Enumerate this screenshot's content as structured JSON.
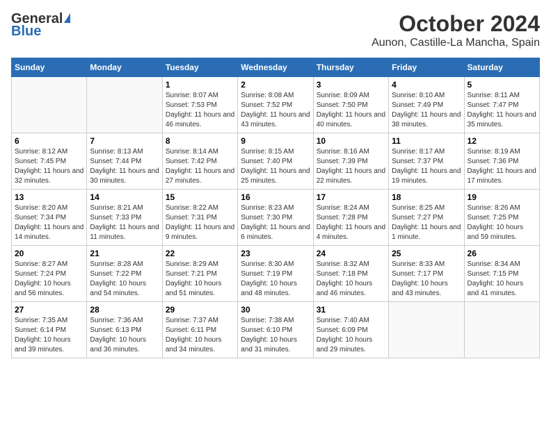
{
  "header": {
    "logo_general": "General",
    "logo_blue": "Blue",
    "month_title": "October 2024",
    "location": "Aunon, Castille-La Mancha, Spain"
  },
  "weekdays": [
    "Sunday",
    "Monday",
    "Tuesday",
    "Wednesday",
    "Thursday",
    "Friday",
    "Saturday"
  ],
  "weeks": [
    [
      {
        "day": "",
        "info": ""
      },
      {
        "day": "",
        "info": ""
      },
      {
        "day": "1",
        "info": "Sunrise: 8:07 AM\nSunset: 7:53 PM\nDaylight: 11 hours and 46 minutes."
      },
      {
        "day": "2",
        "info": "Sunrise: 8:08 AM\nSunset: 7:52 PM\nDaylight: 11 hours and 43 minutes."
      },
      {
        "day": "3",
        "info": "Sunrise: 8:09 AM\nSunset: 7:50 PM\nDaylight: 11 hours and 40 minutes."
      },
      {
        "day": "4",
        "info": "Sunrise: 8:10 AM\nSunset: 7:49 PM\nDaylight: 11 hours and 38 minutes."
      },
      {
        "day": "5",
        "info": "Sunrise: 8:11 AM\nSunset: 7:47 PM\nDaylight: 11 hours and 35 minutes."
      }
    ],
    [
      {
        "day": "6",
        "info": "Sunrise: 8:12 AM\nSunset: 7:45 PM\nDaylight: 11 hours and 32 minutes."
      },
      {
        "day": "7",
        "info": "Sunrise: 8:13 AM\nSunset: 7:44 PM\nDaylight: 11 hours and 30 minutes."
      },
      {
        "day": "8",
        "info": "Sunrise: 8:14 AM\nSunset: 7:42 PM\nDaylight: 11 hours and 27 minutes."
      },
      {
        "day": "9",
        "info": "Sunrise: 8:15 AM\nSunset: 7:40 PM\nDaylight: 11 hours and 25 minutes."
      },
      {
        "day": "10",
        "info": "Sunrise: 8:16 AM\nSunset: 7:39 PM\nDaylight: 11 hours and 22 minutes."
      },
      {
        "day": "11",
        "info": "Sunrise: 8:17 AM\nSunset: 7:37 PM\nDaylight: 11 hours and 19 minutes."
      },
      {
        "day": "12",
        "info": "Sunrise: 8:19 AM\nSunset: 7:36 PM\nDaylight: 11 hours and 17 minutes."
      }
    ],
    [
      {
        "day": "13",
        "info": "Sunrise: 8:20 AM\nSunset: 7:34 PM\nDaylight: 11 hours and 14 minutes."
      },
      {
        "day": "14",
        "info": "Sunrise: 8:21 AM\nSunset: 7:33 PM\nDaylight: 11 hours and 11 minutes."
      },
      {
        "day": "15",
        "info": "Sunrise: 8:22 AM\nSunset: 7:31 PM\nDaylight: 11 hours and 9 minutes."
      },
      {
        "day": "16",
        "info": "Sunrise: 8:23 AM\nSunset: 7:30 PM\nDaylight: 11 hours and 6 minutes."
      },
      {
        "day": "17",
        "info": "Sunrise: 8:24 AM\nSunset: 7:28 PM\nDaylight: 11 hours and 4 minutes."
      },
      {
        "day": "18",
        "info": "Sunrise: 8:25 AM\nSunset: 7:27 PM\nDaylight: 11 hours and 1 minute."
      },
      {
        "day": "19",
        "info": "Sunrise: 8:26 AM\nSunset: 7:25 PM\nDaylight: 10 hours and 59 minutes."
      }
    ],
    [
      {
        "day": "20",
        "info": "Sunrise: 8:27 AM\nSunset: 7:24 PM\nDaylight: 10 hours and 56 minutes."
      },
      {
        "day": "21",
        "info": "Sunrise: 8:28 AM\nSunset: 7:22 PM\nDaylight: 10 hours and 54 minutes."
      },
      {
        "day": "22",
        "info": "Sunrise: 8:29 AM\nSunset: 7:21 PM\nDaylight: 10 hours and 51 minutes."
      },
      {
        "day": "23",
        "info": "Sunrise: 8:30 AM\nSunset: 7:19 PM\nDaylight: 10 hours and 48 minutes."
      },
      {
        "day": "24",
        "info": "Sunrise: 8:32 AM\nSunset: 7:18 PM\nDaylight: 10 hours and 46 minutes."
      },
      {
        "day": "25",
        "info": "Sunrise: 8:33 AM\nSunset: 7:17 PM\nDaylight: 10 hours and 43 minutes."
      },
      {
        "day": "26",
        "info": "Sunrise: 8:34 AM\nSunset: 7:15 PM\nDaylight: 10 hours and 41 minutes."
      }
    ],
    [
      {
        "day": "27",
        "info": "Sunrise: 7:35 AM\nSunset: 6:14 PM\nDaylight: 10 hours and 39 minutes."
      },
      {
        "day": "28",
        "info": "Sunrise: 7:36 AM\nSunset: 6:13 PM\nDaylight: 10 hours and 36 minutes."
      },
      {
        "day": "29",
        "info": "Sunrise: 7:37 AM\nSunset: 6:11 PM\nDaylight: 10 hours and 34 minutes."
      },
      {
        "day": "30",
        "info": "Sunrise: 7:38 AM\nSunset: 6:10 PM\nDaylight: 10 hours and 31 minutes."
      },
      {
        "day": "31",
        "info": "Sunrise: 7:40 AM\nSunset: 6:09 PM\nDaylight: 10 hours and 29 minutes."
      },
      {
        "day": "",
        "info": ""
      },
      {
        "day": "",
        "info": ""
      }
    ]
  ]
}
